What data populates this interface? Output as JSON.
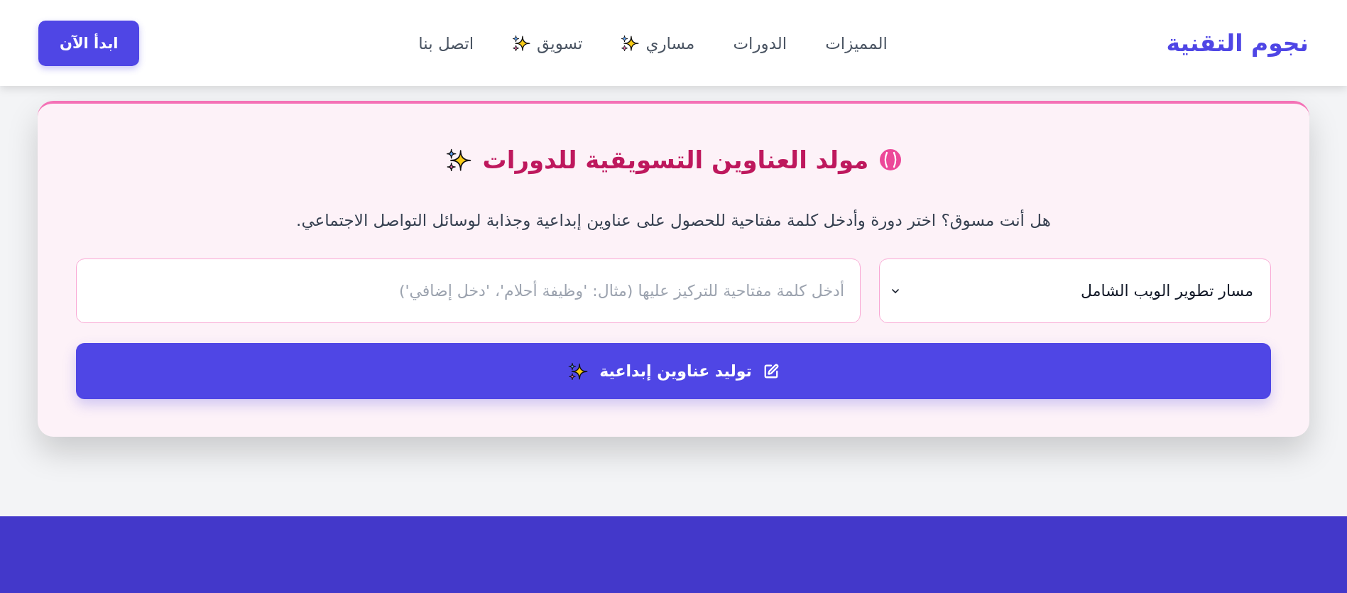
{
  "header": {
    "logo": "نجوم التقنية",
    "nav": [
      {
        "label": "المميزات",
        "sparkle": false
      },
      {
        "label": "الدورات",
        "sparkle": false
      },
      {
        "label": "مساري",
        "sparkle": true
      },
      {
        "label": "تسويق",
        "sparkle": true
      },
      {
        "label": "اتصل بنا",
        "sparkle": false
      }
    ],
    "cta_button": "ابدأ الآن"
  },
  "generator": {
    "title": "مولد العناوين التسويقية للدورات",
    "description": "هل أنت مسوق؟ اختر دورة وأدخل كلمة مفتاحية للحصول على عناوين إبداعية وجذابة لوسائل التواصل الاجتماعي.",
    "course_select": {
      "value": "مسار تطوير الويب الشامل"
    },
    "keyword_input": {
      "placeholder": "أدخل كلمة مفتاحية للتركيز عليها (مثال: 'وظيفة أحلام'، 'دخل إضافي')"
    },
    "generate_button": "توليد عناوين إبداعية"
  }
}
